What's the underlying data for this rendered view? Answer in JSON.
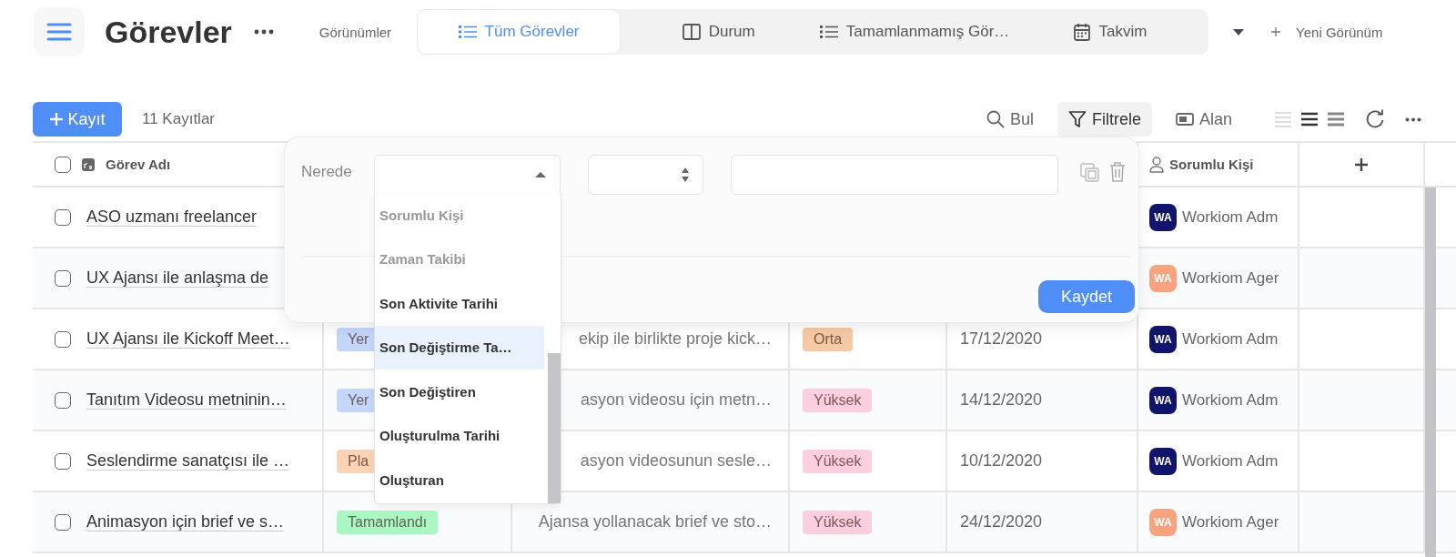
{
  "header": {
    "title": "Görevler",
    "views_label": "Görünümler",
    "tabs": [
      {
        "label": "Tüm Görevler",
        "kind": "list",
        "selected": true
      },
      {
        "label": "Durum",
        "kind": "board",
        "selected": false
      },
      {
        "label": "Tamamlanmamış Gör…",
        "kind": "list",
        "selected": false
      },
      {
        "label": "Takvim",
        "kind": "calendar",
        "selected": false
      }
    ],
    "new_view": "Yeni Görünüm"
  },
  "toolbar": {
    "add_button": "Kayıt",
    "record_count": "11 Kayıtlar",
    "find": "Bul",
    "filter": "Filtrele",
    "filter_active": true,
    "fields": "Alan",
    "density": [
      {
        "selected": false
      },
      {
        "selected": true
      },
      {
        "selected": false
      }
    ]
  },
  "table": {
    "select_all_checked": false,
    "name_column": "Görev Adı",
    "person_column": "Sorumlu Kişi",
    "rows": [
      {
        "checked": false,
        "name": "ASO uzmanı freelancer",
        "person": {
          "initials": "WA",
          "name": "Workiom Adm",
          "color": "#10146a"
        }
      },
      {
        "checked": false,
        "name": "UX Ajansı ile anlaşma de",
        "person": {
          "initials": "WA",
          "name": "Workiom Ager",
          "color": "#f7a47e"
        }
      },
      {
        "checked": false,
        "name": "UX Ajansı ile Kickoff Meet…",
        "status": {
          "text": "Yer",
          "color": "#c5d6fb"
        },
        "description": "ekip ile birlikte proje kick…",
        "priority": {
          "text": "Orta",
          "color": "#f6c9a6"
        },
        "date": "17/12/2020",
        "person": {
          "initials": "WA",
          "name": "Workiom Adm",
          "color": "#10146a"
        }
      },
      {
        "checked": false,
        "name": "Tanıtım Videosu metninin…",
        "status": {
          "text": "Yer",
          "color": "#c5d6fb"
        },
        "description": "asyon videosu için metn…",
        "priority": {
          "text": "Yüksek",
          "color": "#fdcde0"
        },
        "date": "14/12/2020",
        "person": {
          "initials": "WA",
          "name": "Workiom Adm",
          "color": "#10146a"
        }
      },
      {
        "checked": false,
        "name": "Seslendirme sanatçısı ile …",
        "status": {
          "text": "Pla",
          "color": "#fcd3b5"
        },
        "description": "asyon videosunun sesle…",
        "priority": {
          "text": "Yüksek",
          "color": "#fdcde0"
        },
        "date": "10/12/2020",
        "person": {
          "initials": "WA",
          "name": "Workiom Adm",
          "color": "#10146a"
        }
      },
      {
        "checked": false,
        "name": "Animasyon için brief ve s…",
        "status": {
          "text": "Tamamlandı",
          "color": "#aaf7c4"
        },
        "description": "Ajansa yollanacak brief ve sto…",
        "priority": {
          "text": "Yüksek",
          "color": "#fdcde0"
        },
        "date": "24/12/2020",
        "person": {
          "initials": "WA",
          "name": "Workiom Ager",
          "color": "#f7a47e"
        }
      }
    ]
  },
  "filter_popover": {
    "where_label": "Nerede",
    "save_button": "Kaydet",
    "field_options": [
      {
        "label": "Sorumlu Kişi",
        "disabled": true,
        "selected": false
      },
      {
        "label": "Zaman Takibi",
        "disabled": true,
        "selected": false
      },
      {
        "label": "Son Aktivite Tarihi",
        "disabled": false,
        "selected": false
      },
      {
        "label": "Son Değiştirme Ta…",
        "disabled": false,
        "selected": true
      },
      {
        "label": "Son Değiştiren",
        "disabled": false,
        "selected": false
      },
      {
        "label": "Oluşturulma Tarihi",
        "disabled": false,
        "selected": false
      },
      {
        "label": "Oluşturan",
        "disabled": false,
        "selected": false
      }
    ]
  }
}
